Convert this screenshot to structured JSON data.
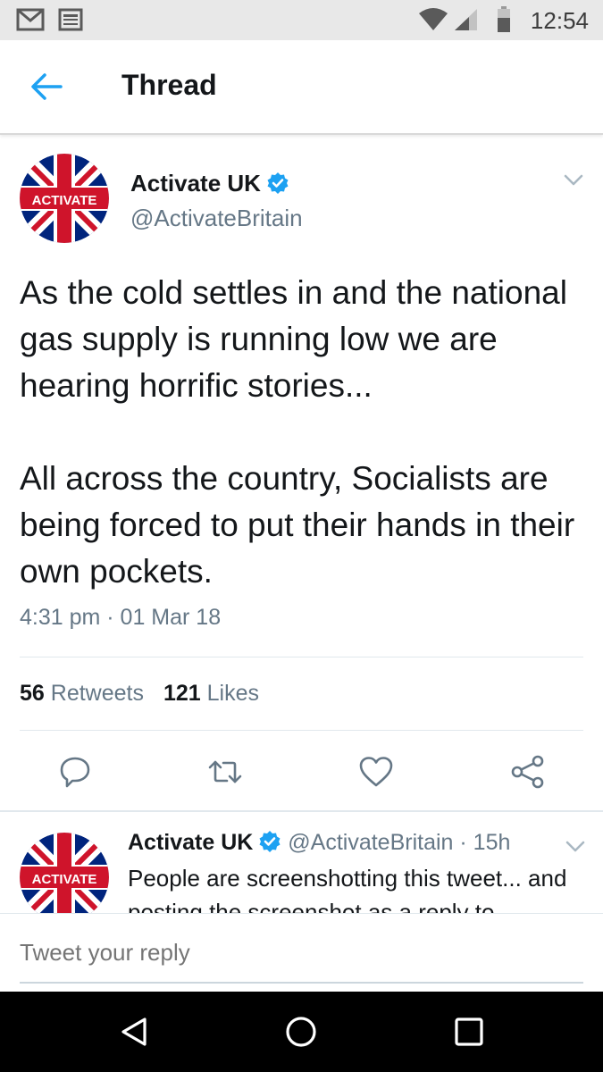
{
  "status_bar": {
    "time": "12:54",
    "icons": [
      "gmail-icon",
      "news-icon",
      "wifi-icon",
      "signal-icon",
      "battery-icon"
    ]
  },
  "app_bar": {
    "back_icon": "back-arrow-icon",
    "title": "Thread"
  },
  "main_tweet": {
    "author_name": "Activate UK",
    "handle": "@ActivateBritain",
    "avatar_text": "ACTIVATE",
    "paragraphs": [
      "As the cold settles in and the national gas supply is running low we are hearing horrific stories...",
      "All across the country, Socialists are being forced to put their hands in their own pockets."
    ],
    "timestamp": "4:31 pm · 01 Mar 18",
    "retweets_count": "56",
    "retweets_label": "Retweets",
    "likes_count": "121",
    "likes_label": "Likes",
    "actions": [
      "reply-icon",
      "retweet-icon",
      "like-icon",
      "share-icon"
    ]
  },
  "reply_tweet": {
    "author_name": "Activate UK",
    "handle": "@ActivateBritain",
    "time": "· 15h",
    "avatar_text": "ACTIVATE",
    "text": "People are screenshotting this tweet... and posting the screenshot as a reply to"
  },
  "composer": {
    "placeholder": "Tweet your reply"
  },
  "nav_bar": {
    "buttons": [
      "back-triangle-icon",
      "home-circle-icon",
      "recents-square-icon"
    ]
  },
  "colors": {
    "accent": "#1da1f2",
    "verified": "#1da1f2",
    "secondary_text": "#657786",
    "flag_red": "#cf142b",
    "flag_blue": "#00247d"
  }
}
